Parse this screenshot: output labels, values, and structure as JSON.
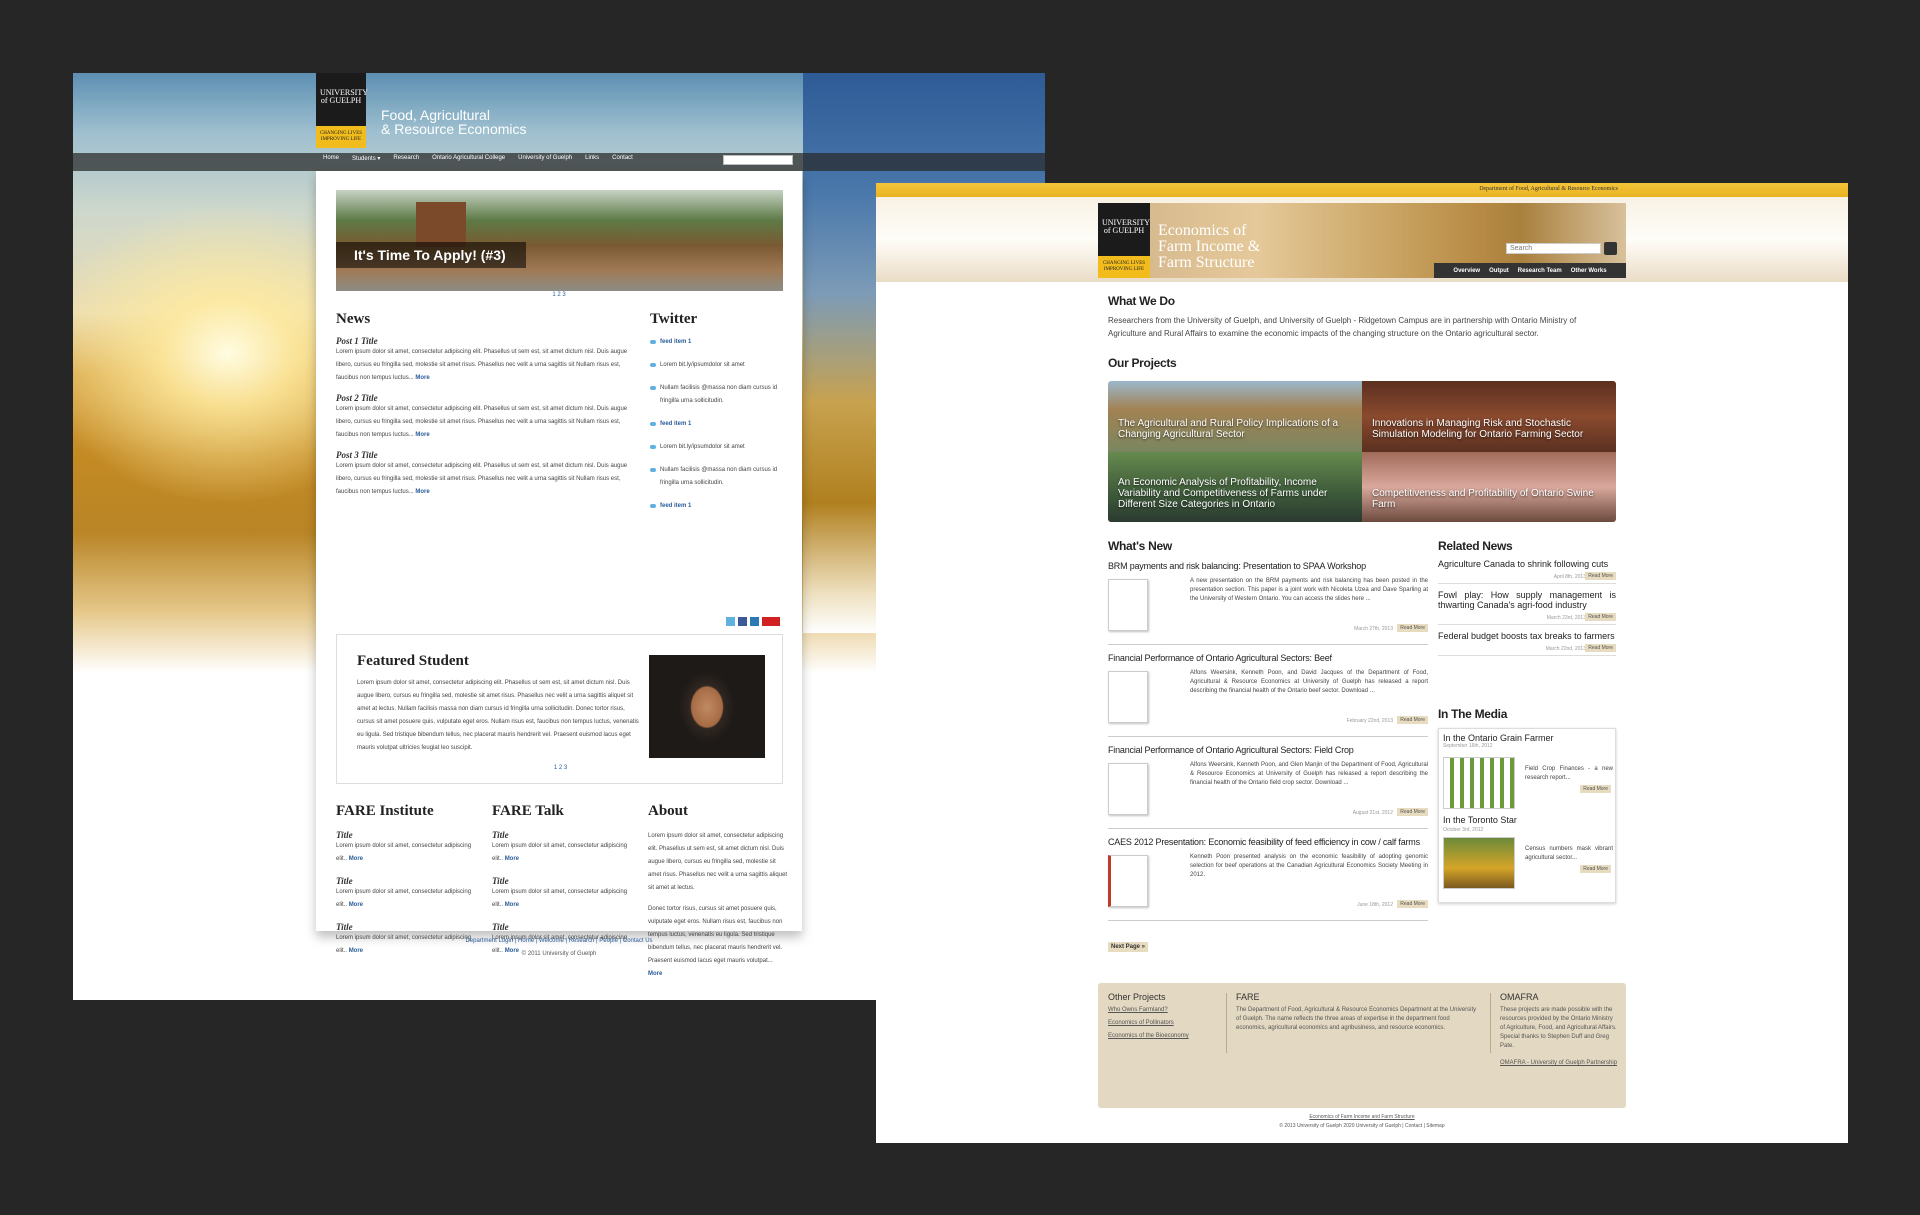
{
  "left": {
    "logo": "UNIVERSITY of GUELPH",
    "logo_tag": "CHANGING LIVES IMPROVING LIFE",
    "site_title_1": "Food, Agricultural",
    "site_title_2": "& Resource Economics",
    "nav": [
      "Home",
      "Students ▾",
      "Research",
      "Ontario Agricultural College",
      "University of Guelph",
      "Links",
      "Contact"
    ],
    "hero_title": "It's Time To Apply! (#3)",
    "hero_pager": "1 2 3",
    "news": {
      "heading": "News",
      "posts": [
        {
          "title": "Post 1 Title",
          "text": "Lorem ipsum dolor sit amet, consectetur adipiscing elit. Phasellus ut sem est, sit amet dictum nisl. Duis augue libero, cursus eu fringilla sed, molestie sit amet risus. Phasellus nec velit a urna sagittis sit Nullam risus est, faucibus non tempus luctus...",
          "more": "More"
        },
        {
          "title": "Post 2 Title",
          "text": "Lorem ipsum dolor sit amet, consectetur adipiscing elit. Phasellus ut sem est, sit amet dictum nisl. Duis augue libero, cursus eu fringilla sed, molestie sit amet risus. Phasellus nec velit a urna sagittis sit Nullam risus est, faucibus non tempus luctus...",
          "more": "More"
        },
        {
          "title": "Post 3 Title",
          "text": "Lorem ipsum dolor sit amet, consectetur adipiscing elit. Phasellus ut sem est, sit amet dictum nisl. Duis augue libero, cursus eu fringilla sed, molestie sit amet risus. Phasellus nec velit a urna sagittis sit Nullam risus est, faucibus non tempus luctus...",
          "more": "More"
        }
      ]
    },
    "twitter": {
      "heading": "Twitter",
      "items": [
        "feed item 1",
        "Lorem bit.ly/ipsumdolor sit amet",
        "Nullam facilisis @massa non diam cursus id fringilla urna sollicitudin.",
        "feed item 1",
        "Lorem bit.ly/ipsumdolor sit amet",
        "Nullam facilisis @massa non diam cursus id fringilla urna sollicitudin.",
        "feed item 1"
      ]
    },
    "featured": {
      "heading": "Featured Student",
      "text": "Lorem ipsum dolor sit amet, consectetur adipiscing elit. Phasellus ut sem est, sit amet dictum nisl. Duis augue libero, cursus eu fringilla sed, molestie sit amet risus. Phasellus nec velit a urna sagittis aliquet sit amet at lectus. Nullam facilisis massa non diam cursus id fringilla urna sollicitudin. Donec tortor risus, cursus sit amet posuere quis, vulputate eget eros. Nullam risus est, faucibus non tempus luctus, venenatis eu ligula. Sed tristique bibendum tellus, nec placerat mauris hendrerit vel. Praesent euismod lacus eget mauris volutpat ultricies feugiat leo suscipit.",
      "pager": "1 2 3"
    },
    "fare_institute": {
      "heading": "FARE Institute",
      "items": [
        {
          "title": "Title",
          "text": "Lorem ipsum dolor sit amet, consectetur adipiscing elit..",
          "more": "More"
        },
        {
          "title": "Title",
          "text": "Lorem ipsum dolor sit amet, consectetur adipiscing elit..",
          "more": "More"
        },
        {
          "title": "Title",
          "text": "Lorem ipsum dolor sit amet, consectetur adipiscing elit..",
          "more": "More"
        }
      ]
    },
    "fare_talk": {
      "heading": "FARE Talk",
      "items": [
        {
          "title": "Title",
          "text": "Lorem ipsum dolor sit amet, consectetur adipiscing elit..",
          "more": "More"
        },
        {
          "title": "Title",
          "text": "Lorem ipsum dolor sit amet, consectetur adipiscing elit..",
          "more": "More"
        },
        {
          "title": "Title",
          "text": "Lorem ipsum dolor sit amet, consectetur adipiscing elit..",
          "more": "More"
        }
      ]
    },
    "about": {
      "heading": "About",
      "text1": "Lorem ipsum dolor sit amet, consectetur adipiscing elit. Phasellus ut sem est, sit amet dictum nisl. Duis augue libero, cursus eu fringilla sed, molestie sit amet risus. Phasellus nec velit a urna sagittis aliquet sit amet at lectus.",
      "text2": "Donec tortor risus, cursus sit amet posuere quis, vulputate eget eros. Nullam risus est, faucibus non tempus luctus, venenatis eu ligula. Sed tristique bibendum tellus, nec placerat mauris hendrerit vel. Praesent euismod lacus eget mauris volutpat...",
      "more": "More"
    },
    "footer_links": "Department Login | Home | Welcome | Research | People | Contact Us",
    "copyright": "© 2011 University of Guelph"
  },
  "right": {
    "dept": "Department of Food, Agricultural & Resource Economics",
    "logo": "UNIVERSITY of GUELPH",
    "logo_tag": "CHANGING LIVES IMPROVING LIFE",
    "site_title": [
      "Economics of",
      "Farm Income &",
      "Farm Structure"
    ],
    "search_placeholder": "Search",
    "nav": [
      "Overview",
      "Output",
      "Research Team",
      "Other Works"
    ],
    "what_we_do": {
      "heading": "What We Do",
      "text": "Researchers from the University of Guelph, and University of Guelph - Ridgetown Campus are in partnership with Ontario Ministry of Agriculture and Rural Affairs to examine the economic impacts of the changing structure on the Ontario agricultural sector."
    },
    "our_projects": {
      "heading": "Our Projects",
      "items": [
        "The Agricultural and Rural Policy Implications of a Changing Agricultural Sector",
        "Innovations in Managing Risk and Stochastic Simulation Modeling for Ontario Farming Sector",
        "An Economic Analysis of Profitability, Income Variability and Competitiveness of Farms under Different Size Categories in Ontario",
        "Competitiveness and Profitability of Ontario Swine Farm"
      ]
    },
    "whats_new": {
      "heading": "What's New",
      "items": [
        {
          "title": "BRM payments and risk balancing: Presentation to SPAA Workshop",
          "desc": "A new presentation on the BRM payments and risk balancing has been posted in the presentation section. This paper is a joint work with Nicoleta Uzea and Dave Sparling at the University of Western Ontario. You can access the slides here ...",
          "date": "March 27th, 2013",
          "rm": "Read More"
        },
        {
          "title": "Financial Performance of Ontario Agricultural Sectors: Beef",
          "desc": "Alfons Weersink, Kenneth Poon, and David Jacques of the Department of Food, Agricultural & Resource Economics at University of Guelph has released a report describing the financial health of the Ontario beef sector. Download ...",
          "date": "February 22nd, 2013",
          "rm": "Read More"
        },
        {
          "title": "Financial Performance of Ontario Agricultural Sectors: Field Crop",
          "desc": "Alfons Weersink, Kenneth Poon, and Glen Manjin of the Department of Food, Agricultural & Resource Economics at University of Guelph has released a report describing the financial health of the Ontario field crop sector. Download ...",
          "date": "August 21st, 2012",
          "rm": "Read More"
        },
        {
          "title": "CAES 2012 Presentation: Economic feasibility of feed efficiency in cow / calf farms",
          "desc": "Kenneth Poon presented analysis on the economic feasibility of adopting genomic selection for beef operations at the Canadian Agricultural Economics Society Meeting in 2012.",
          "date": "June 18th, 2012",
          "rm": "Read More"
        }
      ],
      "next": "Next Page »"
    },
    "related_news": {
      "heading": "Related News",
      "items": [
        {
          "title": "Agriculture Canada to shrink following cuts",
          "date": "April 8th, 2013",
          "rm": "Read More"
        },
        {
          "title": "Fowl play: How supply management is thwarting Canada's agri-food industry",
          "date": "March 23rd, 2013",
          "rm": "Read More"
        },
        {
          "title": "Federal budget boosts tax breaks to farmers",
          "date": "March 22nd, 2013",
          "rm": "Read More"
        }
      ]
    },
    "in_the_media": {
      "heading": "In The Media",
      "items": [
        {
          "source": "In the Ontario Grain Farmer",
          "date": "September 16th, 2012",
          "text": "Field Crop Finances - a new research report...",
          "rm": "Read More"
        },
        {
          "source": "In the Toronto Star",
          "date": "October 3rd, 2012",
          "text": "Census numbers mask vibrant agricultural sector...",
          "rm": "Read More"
        }
      ]
    },
    "footer": {
      "other_projects": {
        "heading": "Other Projects",
        "links": [
          "Who Owns Farmland?",
          "Economics of Pollinators",
          "Economics of the Bioeconomy"
        ]
      },
      "fare": {
        "heading": "FARE",
        "text": "The Department of Food, Agricultural & Resource Economics Department at the University of Guelph. The name reflects the three areas of expertise in the department food economics, agricultural economics and agribusiness, and resource economics."
      },
      "omafra": {
        "heading": "OMAFRA",
        "text": "These projects are made possible with the resources provided by the Ontario Ministry of Agriculture, Food, and Agricultural Affairs. Special thanks to Stephen Duff and Greg Pate.",
        "link": "OMAFRA - University of Guelph Partnership"
      }
    },
    "copyright_1": "Economics of Farm Income and Farm Structure",
    "copyright_2": "© 2013 University of Guelph 2020 University of Guelph | Contact | Sitemap"
  }
}
